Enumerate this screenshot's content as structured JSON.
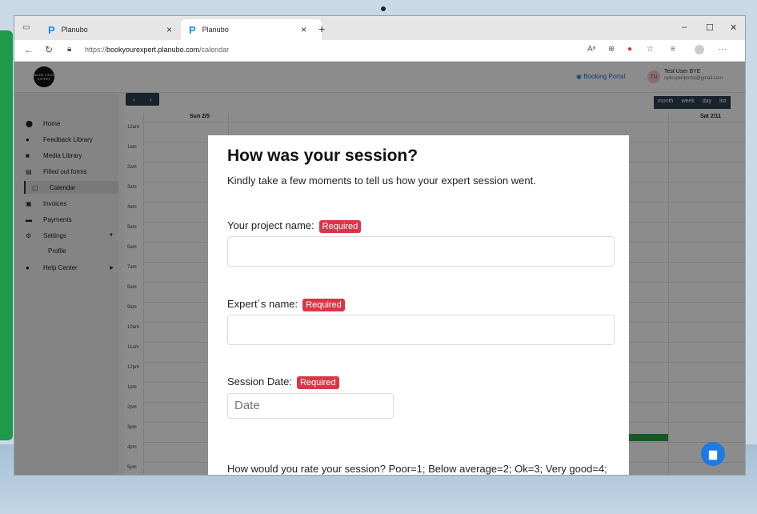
{
  "browser": {
    "tabs": [
      {
        "title": "Planubo",
        "close": "×"
      },
      {
        "title": "Planubo",
        "close": "×"
      }
    ],
    "new_tab": "+",
    "url_prefix": "https://",
    "url_domain": "bookyourexpert.planubo.com",
    "url_path": "/calendar",
    "window": {
      "minimize": "–",
      "maximize": "☐",
      "close": "✕"
    }
  },
  "app": {
    "logo_text": "BOOK YOUR EXPERT",
    "booking_portal": "Booking Portal",
    "user": {
      "initials": "TU",
      "name": "Test User BYE",
      "email": "oplexpertportal@gmail.com"
    },
    "sidebar": [
      {
        "label": "Home",
        "icon": "home-icon"
      },
      {
        "label": "Feedback Library",
        "icon": "chat-icon"
      },
      {
        "label": "Media Library",
        "icon": "media-icon"
      },
      {
        "label": "Filled out forms",
        "icon": "forms-icon"
      },
      {
        "label": "Calendar",
        "icon": "calendar-icon"
      },
      {
        "label": "Invoices",
        "icon": "invoice-icon"
      },
      {
        "label": "Payments",
        "icon": "card-icon"
      },
      {
        "label": "Settings",
        "icon": "gear-icon"
      },
      {
        "label": "Help Center",
        "icon": "info-icon"
      }
    ],
    "settings_sub": "Profile",
    "calendar": {
      "prev": "‹",
      "next": "›",
      "views": [
        "month",
        "week",
        "day",
        "list"
      ],
      "days": [
        "Sun 2/5",
        "Sat 2/11"
      ],
      "hours": [
        "12am",
        "1am",
        "2am",
        "3am",
        "4am",
        "5am",
        "6am",
        "7am",
        "8am",
        "9am",
        "10am",
        "11am",
        "12pm",
        "1pm",
        "2pm",
        "3pm",
        "4pm",
        "5pm"
      ]
    }
  },
  "modal": {
    "title": "How was your session?",
    "subtitle": "Kindly take a few moments to tell us how your expert session went.",
    "project_label": "Your project name:",
    "expert_label": "Expert´s name:",
    "date_label": "Session Date:",
    "date_placeholder": "Date",
    "required": "Required",
    "rate_label": "How would you rate your session? Poor=1; Below average=2; Ok=3; Very good=4; Excellent=5)",
    "stars": "★★★★★"
  }
}
